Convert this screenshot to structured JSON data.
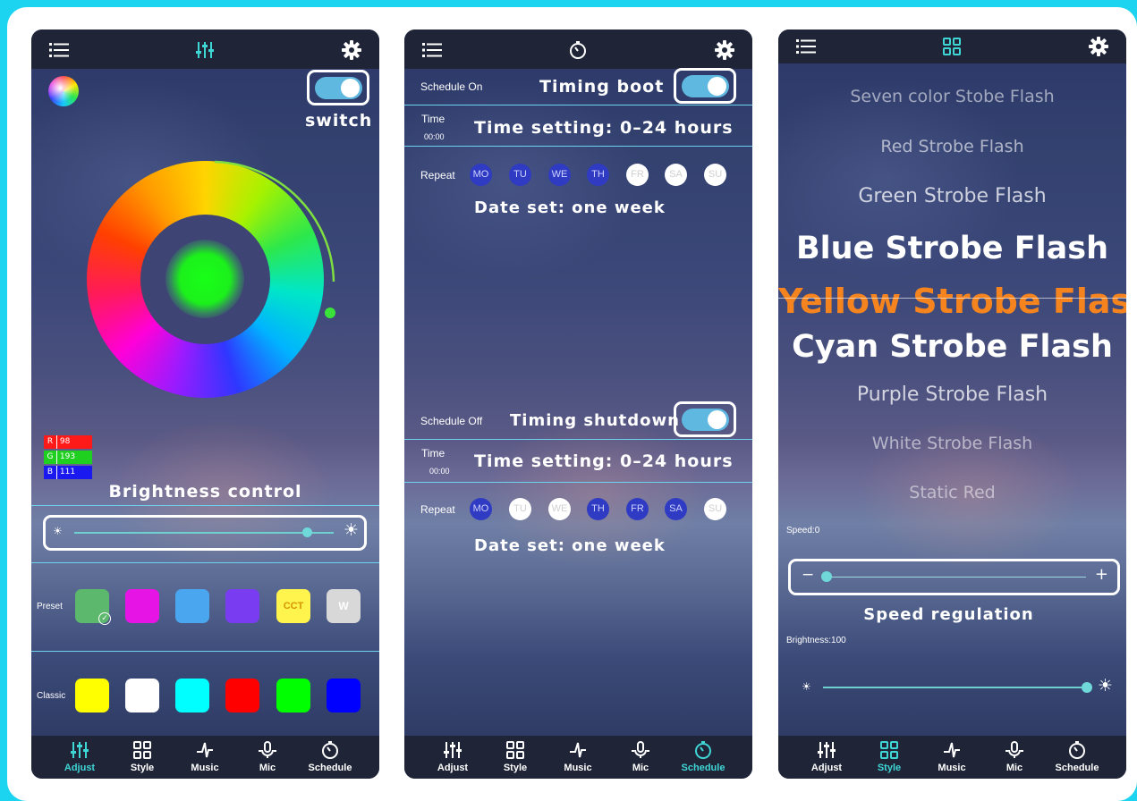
{
  "nav": [
    {
      "label": "Adjust",
      "icon": "sliders-icon"
    },
    {
      "label": "Style",
      "icon": "grid-icon"
    },
    {
      "label": "Music",
      "icon": "music-icon"
    },
    {
      "label": "Mic",
      "icon": "mic-icon"
    },
    {
      "label": "Schedule",
      "icon": "timer-icon"
    }
  ],
  "colors": {
    "accent": "#3fd6d6",
    "highlight": "#f5841f",
    "day_on": "#2f3bc2",
    "bar": "#1f2537",
    "page_bg": "#1cd4ef"
  },
  "adjust": {
    "switch_label": "switch",
    "rgb": [
      {
        "ch": "R",
        "val": "98"
      },
      {
        "ch": "G",
        "val": "193"
      },
      {
        "ch": "B",
        "val": "111"
      }
    ],
    "brightness_label": "Brightness control",
    "brightness_level": 0.9,
    "preset_label": "Preset",
    "preset_swatches": [
      "#5cb86c",
      "#e615e6",
      "#4aa6ee",
      "#7a3cf0",
      "#fff34d",
      "#d8d8d8"
    ],
    "preset_text": {
      "cct": "CCT",
      "w": "W"
    },
    "classic_label": "Classic",
    "classic_swatches": [
      "#ffff00",
      "#ffffff",
      "#00ffff",
      "#ff0000",
      "#00ff00",
      "#0000ff"
    ]
  },
  "schedule": {
    "on": {
      "status": "Schedule On",
      "title": "Timing boot",
      "time_label": "Time",
      "time_value": "00:00",
      "time_setting": "Time setting: 0–24 hours",
      "repeat_label": "Repeat",
      "date_set": "Date set: one week",
      "days": [
        {
          "d": "MO",
          "on": true
        },
        {
          "d": "TU",
          "on": true
        },
        {
          "d": "WE",
          "on": true
        },
        {
          "d": "TH",
          "on": true
        },
        {
          "d": "FR",
          "on": false
        },
        {
          "d": "SA",
          "on": false
        },
        {
          "d": "SU",
          "on": false
        }
      ]
    },
    "off": {
      "status": "Schedule Off",
      "title": "Timing shutdown",
      "time_label": "Time",
      "time_value": "00:00",
      "time_setting": "Time setting: 0–24 hours",
      "repeat_label": "Repeat",
      "date_set": "Date set: one week",
      "days": [
        {
          "d": "MO",
          "on": true
        },
        {
          "d": "TU",
          "on": false
        },
        {
          "d": "WE",
          "on": false
        },
        {
          "d": "TH",
          "on": true
        },
        {
          "d": "FR",
          "on": true
        },
        {
          "d": "SA",
          "on": true
        },
        {
          "d": "SU",
          "on": false
        }
      ]
    }
  },
  "style": {
    "effects": [
      "Seven color Stobe Flash",
      "Red Strobe Flash",
      "Green Strobe Flash",
      "Blue Strobe Flash",
      "Yellow Strobe Flash",
      "Cyan Strobe Flash",
      "Purple Strobe Flash",
      "White Strobe Flash",
      "Static Red"
    ],
    "selected_effect": "Yellow Strobe Flash",
    "speed_label": "Speed:0",
    "speed_minus": "−",
    "speed_plus": "+",
    "speed_level": 0,
    "speed_regulation": "Speed regulation",
    "brightness_label": "Brightness:100",
    "brightness_level": 1.0
  }
}
